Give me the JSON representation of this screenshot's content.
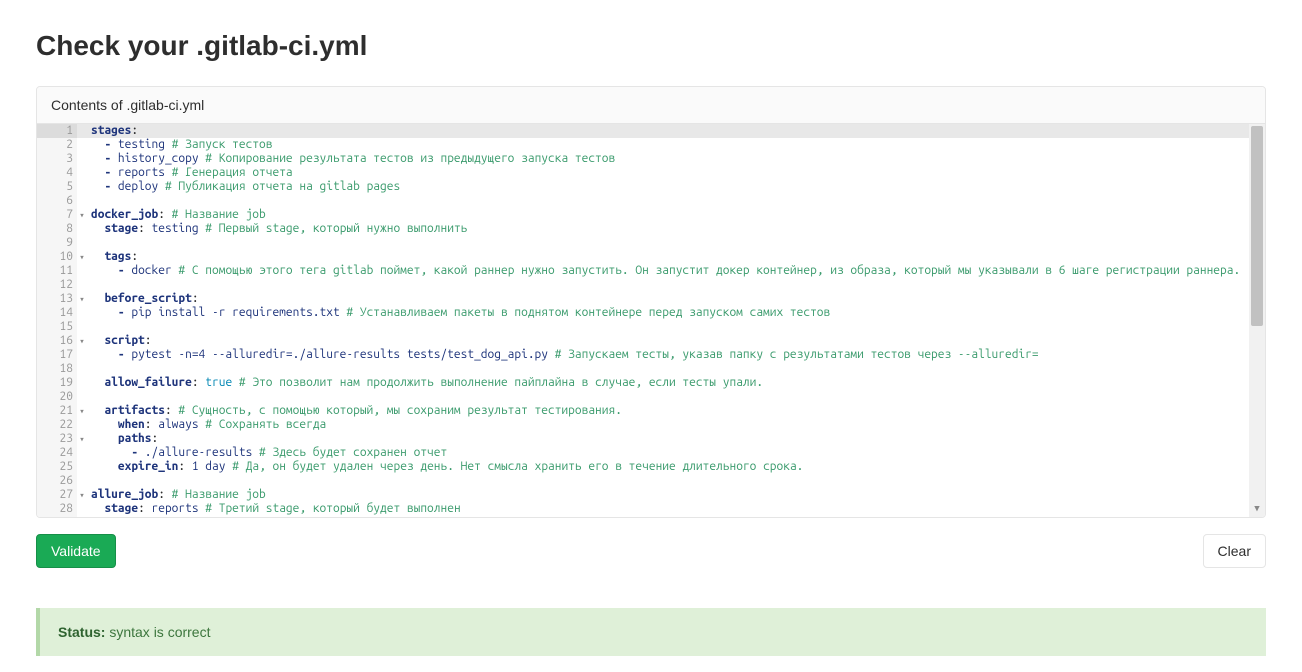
{
  "page": {
    "title": "Check your .gitlab-ci.yml",
    "editor_label": "Contents of .gitlab-ci.yml"
  },
  "buttons": {
    "validate": "Validate",
    "clear": "Clear"
  },
  "status": {
    "label": "Status:",
    "message": "syntax is correct"
  },
  "code": {
    "lines": [
      {
        "n": 1,
        "fold": true,
        "first": true,
        "tokens": [
          [
            "key",
            "stages"
          ],
          [
            "plain",
            ":"
          ]
        ]
      },
      {
        "n": 2,
        "tokens": [
          [
            "plain",
            "  "
          ],
          [
            "dash",
            "- "
          ],
          [
            "str",
            "testing"
          ],
          [
            "plain",
            " "
          ],
          [
            "comment",
            "# Запуск тестов"
          ]
        ]
      },
      {
        "n": 3,
        "tokens": [
          [
            "plain",
            "  "
          ],
          [
            "dash",
            "- "
          ],
          [
            "str",
            "history_copy"
          ],
          [
            "plain",
            " "
          ],
          [
            "comment",
            "# Копирование результата тестов из предыдущего запуска тестов"
          ]
        ]
      },
      {
        "n": 4,
        "tokens": [
          [
            "plain",
            "  "
          ],
          [
            "dash",
            "- "
          ],
          [
            "str",
            "reports"
          ],
          [
            "plain",
            " "
          ],
          [
            "comment",
            "# Генерация отчета"
          ]
        ]
      },
      {
        "n": 5,
        "tokens": [
          [
            "plain",
            "  "
          ],
          [
            "dash",
            "- "
          ],
          [
            "str",
            "deploy"
          ],
          [
            "plain",
            " "
          ],
          [
            "comment",
            "# Публикация отчета на gitlab pages"
          ]
        ]
      },
      {
        "n": 6,
        "tokens": []
      },
      {
        "n": 7,
        "fold": true,
        "tokens": [
          [
            "key",
            "docker_job"
          ],
          [
            "plain",
            ": "
          ],
          [
            "comment",
            "# Название job"
          ]
        ]
      },
      {
        "n": 8,
        "tokens": [
          [
            "plain",
            "  "
          ],
          [
            "key",
            "stage"
          ],
          [
            "plain",
            ": "
          ],
          [
            "str",
            "testing"
          ],
          [
            "plain",
            " "
          ],
          [
            "comment",
            "# Первый stage, который нужно выполнить"
          ]
        ]
      },
      {
        "n": 9,
        "tokens": []
      },
      {
        "n": 10,
        "fold": true,
        "tokens": [
          [
            "plain",
            "  "
          ],
          [
            "key",
            "tags"
          ],
          [
            "plain",
            ":"
          ]
        ]
      },
      {
        "n": 11,
        "tokens": [
          [
            "plain",
            "    "
          ],
          [
            "dash",
            "- "
          ],
          [
            "str",
            "docker"
          ],
          [
            "plain",
            " "
          ],
          [
            "comment",
            "# С помощью этого тега gitlab поймет, какой раннер нужно запустить. Он запустит докер контейнер, из образа, который мы указывали в 6 шаге регистрации раннера."
          ]
        ]
      },
      {
        "n": 12,
        "tokens": []
      },
      {
        "n": 13,
        "fold": true,
        "tokens": [
          [
            "plain",
            "  "
          ],
          [
            "key",
            "before_script"
          ],
          [
            "plain",
            ":"
          ]
        ]
      },
      {
        "n": 14,
        "tokens": [
          [
            "plain",
            "    "
          ],
          [
            "dash",
            "- "
          ],
          [
            "str",
            "pip install -r requirements.txt"
          ],
          [
            "plain",
            " "
          ],
          [
            "comment",
            "# Устанавливаем пакеты в поднятом контейнере перед запуском самих тестов"
          ]
        ]
      },
      {
        "n": 15,
        "tokens": []
      },
      {
        "n": 16,
        "fold": true,
        "tokens": [
          [
            "plain",
            "  "
          ],
          [
            "key",
            "script"
          ],
          [
            "plain",
            ":"
          ]
        ]
      },
      {
        "n": 17,
        "tokens": [
          [
            "plain",
            "    "
          ],
          [
            "dash",
            "- "
          ],
          [
            "str",
            "pytest -n=4 --alluredir=./allure-results tests/test_dog_api.py"
          ],
          [
            "plain",
            " "
          ],
          [
            "comment",
            "# Запускаем тесты, указав папку с результатами тестов через --alluredir="
          ]
        ]
      },
      {
        "n": 18,
        "tokens": []
      },
      {
        "n": 19,
        "tokens": [
          [
            "plain",
            "  "
          ],
          [
            "key",
            "allow_failure"
          ],
          [
            "plain",
            ": "
          ],
          [
            "bool",
            "true"
          ],
          [
            "plain",
            " "
          ],
          [
            "comment",
            "# Это позволит нам продолжить выполнение пайплайна в случае, если тесты упали."
          ]
        ]
      },
      {
        "n": 20,
        "tokens": []
      },
      {
        "n": 21,
        "fold": true,
        "tokens": [
          [
            "plain",
            "  "
          ],
          [
            "key",
            "artifacts"
          ],
          [
            "plain",
            ": "
          ],
          [
            "comment",
            "# Сущность, с помощью который, мы сохраним результат тестирования."
          ]
        ]
      },
      {
        "n": 22,
        "tokens": [
          [
            "plain",
            "    "
          ],
          [
            "key",
            "when"
          ],
          [
            "plain",
            ": "
          ],
          [
            "str",
            "always"
          ],
          [
            "plain",
            " "
          ],
          [
            "comment",
            "# Сохранять всегда"
          ]
        ]
      },
      {
        "n": 23,
        "fold": true,
        "tokens": [
          [
            "plain",
            "    "
          ],
          [
            "key",
            "paths"
          ],
          [
            "plain",
            ":"
          ]
        ]
      },
      {
        "n": 24,
        "tokens": [
          [
            "plain",
            "      "
          ],
          [
            "dash",
            "- "
          ],
          [
            "str",
            "./allure-results"
          ],
          [
            "plain",
            " "
          ],
          [
            "comment",
            "# Здесь будет сохранен отчет"
          ]
        ]
      },
      {
        "n": 25,
        "tokens": [
          [
            "plain",
            "    "
          ],
          [
            "key",
            "expire_in"
          ],
          [
            "plain",
            ": "
          ],
          [
            "num",
            "1"
          ],
          [
            "plain",
            " "
          ],
          [
            "str",
            "day"
          ],
          [
            "plain",
            " "
          ],
          [
            "comment",
            "# Да, он будет удален через день. Нет смысла хранить его в течение длительного срока."
          ]
        ]
      },
      {
        "n": 26,
        "tokens": []
      },
      {
        "n": 27,
        "fold": true,
        "tokens": [
          [
            "key",
            "allure_job"
          ],
          [
            "plain",
            ": "
          ],
          [
            "comment",
            "# Название job"
          ]
        ]
      },
      {
        "n": 28,
        "tokens": [
          [
            "plain",
            "  "
          ],
          [
            "key",
            "stage"
          ],
          [
            "plain",
            ": "
          ],
          [
            "str",
            "reports"
          ],
          [
            "plain",
            " "
          ],
          [
            "comment",
            "# Третий stage, который будет выполнен"
          ]
        ]
      }
    ]
  }
}
